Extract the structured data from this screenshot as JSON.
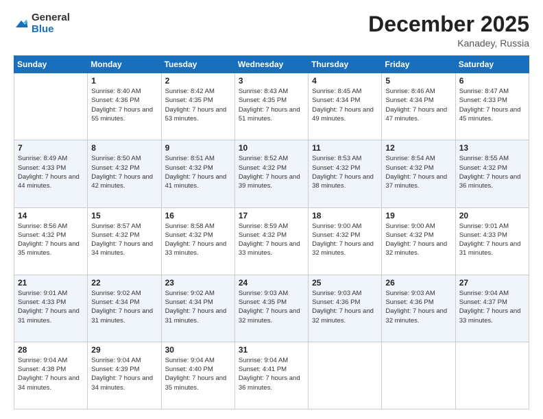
{
  "header": {
    "logo_general": "General",
    "logo_blue": "Blue",
    "month_title": "December 2025",
    "location": "Kanadey, Russia"
  },
  "days_of_week": [
    "Sunday",
    "Monday",
    "Tuesday",
    "Wednesday",
    "Thursday",
    "Friday",
    "Saturday"
  ],
  "weeks": [
    [
      {
        "day": "",
        "sunrise": "",
        "sunset": "",
        "daylight": ""
      },
      {
        "day": "1",
        "sunrise": "Sunrise: 8:40 AM",
        "sunset": "Sunset: 4:36 PM",
        "daylight": "Daylight: 7 hours and 55 minutes."
      },
      {
        "day": "2",
        "sunrise": "Sunrise: 8:42 AM",
        "sunset": "Sunset: 4:35 PM",
        "daylight": "Daylight: 7 hours and 53 minutes."
      },
      {
        "day": "3",
        "sunrise": "Sunrise: 8:43 AM",
        "sunset": "Sunset: 4:35 PM",
        "daylight": "Daylight: 7 hours and 51 minutes."
      },
      {
        "day": "4",
        "sunrise": "Sunrise: 8:45 AM",
        "sunset": "Sunset: 4:34 PM",
        "daylight": "Daylight: 7 hours and 49 minutes."
      },
      {
        "day": "5",
        "sunrise": "Sunrise: 8:46 AM",
        "sunset": "Sunset: 4:34 PM",
        "daylight": "Daylight: 7 hours and 47 minutes."
      },
      {
        "day": "6",
        "sunrise": "Sunrise: 8:47 AM",
        "sunset": "Sunset: 4:33 PM",
        "daylight": "Daylight: 7 hours and 45 minutes."
      }
    ],
    [
      {
        "day": "7",
        "sunrise": "Sunrise: 8:49 AM",
        "sunset": "Sunset: 4:33 PM",
        "daylight": "Daylight: 7 hours and 44 minutes."
      },
      {
        "day": "8",
        "sunrise": "Sunrise: 8:50 AM",
        "sunset": "Sunset: 4:32 PM",
        "daylight": "Daylight: 7 hours and 42 minutes."
      },
      {
        "day": "9",
        "sunrise": "Sunrise: 8:51 AM",
        "sunset": "Sunset: 4:32 PM",
        "daylight": "Daylight: 7 hours and 41 minutes."
      },
      {
        "day": "10",
        "sunrise": "Sunrise: 8:52 AM",
        "sunset": "Sunset: 4:32 PM",
        "daylight": "Daylight: 7 hours and 39 minutes."
      },
      {
        "day": "11",
        "sunrise": "Sunrise: 8:53 AM",
        "sunset": "Sunset: 4:32 PM",
        "daylight": "Daylight: 7 hours and 38 minutes."
      },
      {
        "day": "12",
        "sunrise": "Sunrise: 8:54 AM",
        "sunset": "Sunset: 4:32 PM",
        "daylight": "Daylight: 7 hours and 37 minutes."
      },
      {
        "day": "13",
        "sunrise": "Sunrise: 8:55 AM",
        "sunset": "Sunset: 4:32 PM",
        "daylight": "Daylight: 7 hours and 36 minutes."
      }
    ],
    [
      {
        "day": "14",
        "sunrise": "Sunrise: 8:56 AM",
        "sunset": "Sunset: 4:32 PM",
        "daylight": "Daylight: 7 hours and 35 minutes."
      },
      {
        "day": "15",
        "sunrise": "Sunrise: 8:57 AM",
        "sunset": "Sunset: 4:32 PM",
        "daylight": "Daylight: 7 hours and 34 minutes."
      },
      {
        "day": "16",
        "sunrise": "Sunrise: 8:58 AM",
        "sunset": "Sunset: 4:32 PM",
        "daylight": "Daylight: 7 hours and 33 minutes."
      },
      {
        "day": "17",
        "sunrise": "Sunrise: 8:59 AM",
        "sunset": "Sunset: 4:32 PM",
        "daylight": "Daylight: 7 hours and 33 minutes."
      },
      {
        "day": "18",
        "sunrise": "Sunrise: 9:00 AM",
        "sunset": "Sunset: 4:32 PM",
        "daylight": "Daylight: 7 hours and 32 minutes."
      },
      {
        "day": "19",
        "sunrise": "Sunrise: 9:00 AM",
        "sunset": "Sunset: 4:32 PM",
        "daylight": "Daylight: 7 hours and 32 minutes."
      },
      {
        "day": "20",
        "sunrise": "Sunrise: 9:01 AM",
        "sunset": "Sunset: 4:33 PM",
        "daylight": "Daylight: 7 hours and 31 minutes."
      }
    ],
    [
      {
        "day": "21",
        "sunrise": "Sunrise: 9:01 AM",
        "sunset": "Sunset: 4:33 PM",
        "daylight": "Daylight: 7 hours and 31 minutes."
      },
      {
        "day": "22",
        "sunrise": "Sunrise: 9:02 AM",
        "sunset": "Sunset: 4:34 PM",
        "daylight": "Daylight: 7 hours and 31 minutes."
      },
      {
        "day": "23",
        "sunrise": "Sunrise: 9:02 AM",
        "sunset": "Sunset: 4:34 PM",
        "daylight": "Daylight: 7 hours and 31 minutes."
      },
      {
        "day": "24",
        "sunrise": "Sunrise: 9:03 AM",
        "sunset": "Sunset: 4:35 PM",
        "daylight": "Daylight: 7 hours and 32 minutes."
      },
      {
        "day": "25",
        "sunrise": "Sunrise: 9:03 AM",
        "sunset": "Sunset: 4:36 PM",
        "daylight": "Daylight: 7 hours and 32 minutes."
      },
      {
        "day": "26",
        "sunrise": "Sunrise: 9:03 AM",
        "sunset": "Sunset: 4:36 PM",
        "daylight": "Daylight: 7 hours and 32 minutes."
      },
      {
        "day": "27",
        "sunrise": "Sunrise: 9:04 AM",
        "sunset": "Sunset: 4:37 PM",
        "daylight": "Daylight: 7 hours and 33 minutes."
      }
    ],
    [
      {
        "day": "28",
        "sunrise": "Sunrise: 9:04 AM",
        "sunset": "Sunset: 4:38 PM",
        "daylight": "Daylight: 7 hours and 34 minutes."
      },
      {
        "day": "29",
        "sunrise": "Sunrise: 9:04 AM",
        "sunset": "Sunset: 4:39 PM",
        "daylight": "Daylight: 7 hours and 34 minutes."
      },
      {
        "day": "30",
        "sunrise": "Sunrise: 9:04 AM",
        "sunset": "Sunset: 4:40 PM",
        "daylight": "Daylight: 7 hours and 35 minutes."
      },
      {
        "day": "31",
        "sunrise": "Sunrise: 9:04 AM",
        "sunset": "Sunset: 4:41 PM",
        "daylight": "Daylight: 7 hours and 36 minutes."
      },
      {
        "day": "",
        "sunrise": "",
        "sunset": "",
        "daylight": ""
      },
      {
        "day": "",
        "sunrise": "",
        "sunset": "",
        "daylight": ""
      },
      {
        "day": "",
        "sunrise": "",
        "sunset": "",
        "daylight": ""
      }
    ]
  ]
}
